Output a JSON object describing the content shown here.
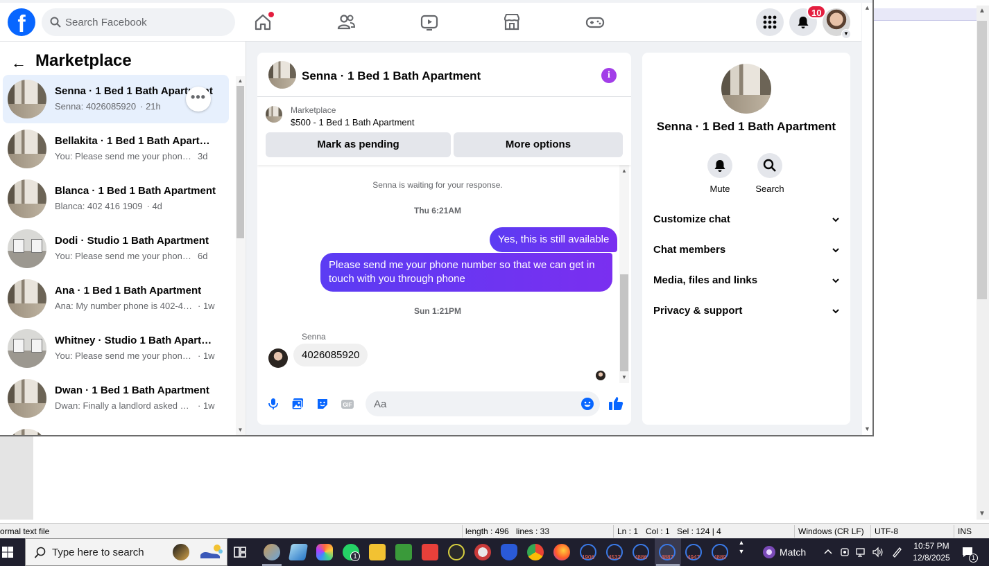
{
  "background_app": {
    "status": {
      "file_type": "ormal text file",
      "length": "length : 496",
      "lines": "lines : 33",
      "ln": "Ln : 1",
      "col": "Col : 1",
      "sel": "Sel : 124 | 4",
      "eol": "Windows (CR LF)",
      "encoding": "UTF-8",
      "mode": "INS"
    }
  },
  "topbar": {
    "logo_letter": "f",
    "search_placeholder": "Search Facebook",
    "notification_count": "10",
    "icons": [
      "home-icon",
      "friends-icon",
      "watch-icon",
      "marketplace-icon",
      "gaming-icon",
      "menu-grid-icon",
      "bell-icon"
    ]
  },
  "left_pane": {
    "title": "Marketplace",
    "conversations": [
      {
        "title": "Senna · 1 Bed 1 Bath Apartment",
        "preview": "Senna: 4026085920",
        "time": "· 21h",
        "thumb": "apt",
        "active": true
      },
      {
        "title": "Bellakita · 1 Bed 1 Bath Apartment",
        "preview": "You: Please send me your phone n...",
        "time": "3d",
        "thumb": "apt"
      },
      {
        "title": "Blanca · 1 Bed 1 Bath Apartment",
        "preview": "Blanca: 402 416 1909",
        "time": "· 4d",
        "thumb": "apt"
      },
      {
        "title": "Dodi · Studio 1 Bath Apartment",
        "preview": "You: Please send me your phone n...",
        "time": "6d",
        "thumb": "studio"
      },
      {
        "title": "Ana · 1 Bed 1 Bath Apartment",
        "preview": "Ana: My number phone is 402-403...",
        "time": "· 1w",
        "thumb": "apt"
      },
      {
        "title": "Whitney · Studio 1 Bath Apartm...",
        "preview": "You: Please send me your phone n...",
        "time": "· 1w",
        "thumb": "studio"
      },
      {
        "title": "Dwan · 1 Bed 1 Bath Apartment",
        "preview": "Dwan: Finally a landlord asked me ...",
        "time": "· 1w",
        "thumb": "apt"
      }
    ]
  },
  "chat": {
    "title": "Senna · 1 Bed 1 Bath Apartment",
    "listing_label": "Marketplace",
    "listing_price": "$500 - 1 Bed 1 Bath Apartment",
    "btn_pending": "Mark as pending",
    "btn_more": "More options",
    "waiting_text": "Senna is waiting for your response.",
    "ts1": "Thu 6:21AM",
    "msg_out_1": "Yes, this is still available",
    "msg_out_2": "Please send me your phone  number so that we can get in touch with you through phone",
    "ts2": "Sun 1:21PM",
    "sender_name": "Senna",
    "msg_in_1": "4026085920",
    "input_placeholder": "Aa"
  },
  "info": {
    "title": "Senna · 1 Bed 1 Bath Apartment",
    "mute_label": "Mute",
    "search_label": "Search",
    "rows": [
      "Customize chat",
      "Chat members",
      "Media, files and links",
      "Privacy & support"
    ]
  },
  "taskbar": {
    "search_placeholder": "Type here to search",
    "match_label": "Match",
    "time": "10:57 PM",
    "date": "12/8/2025",
    "app_numbers": [
      "1906",
      "4532",
      "4886",
      "4887",
      "4947",
      "4889"
    ],
    "whatsapp_badge": "1",
    "notif_badge": "1"
  },
  "colors": {
    "fb_blue": "#0866ff",
    "messenger_gradient_start": "#5b3cf3",
    "messenger_gradient_end": "#7a2ff0",
    "info_purple": "#a23ee8",
    "badge_red": "#e41e3f"
  }
}
